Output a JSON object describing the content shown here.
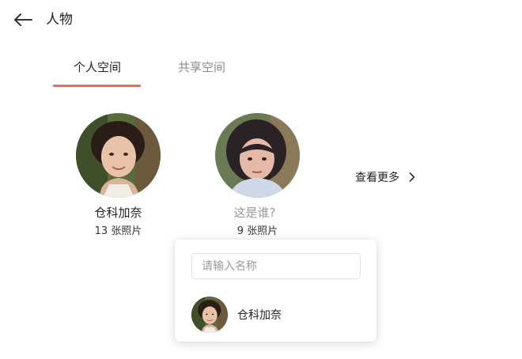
{
  "header": {
    "title": "人物",
    "back_icon": "arrow-left-icon"
  },
  "tabs": [
    {
      "label": "个人空间",
      "active": true
    },
    {
      "label": "共享空间",
      "active": false
    }
  ],
  "accent_color": "#ee6a55",
  "people": [
    {
      "name": "仓科加奈",
      "count": "13 张照片"
    },
    {
      "name": "这是谁?",
      "count": "9 张照片"
    }
  ],
  "see_more": {
    "label": "查看更多",
    "icon": "chevron-right-icon"
  },
  "popover": {
    "input_placeholder": "请输入名称",
    "input_value": "",
    "suggestions": [
      {
        "name": "仓科加奈"
      }
    ]
  }
}
